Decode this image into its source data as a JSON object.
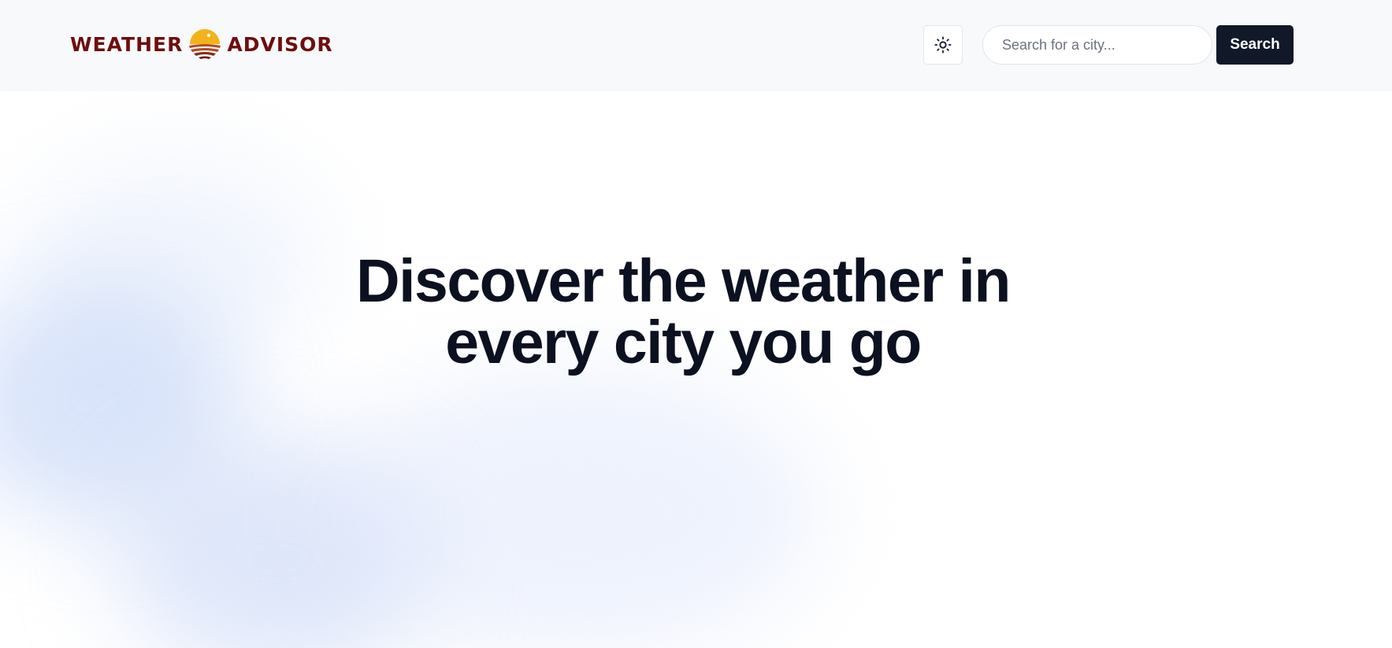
{
  "header": {
    "logo": {
      "word_left": "WEATHER",
      "word_right": "ADVISOR",
      "icon": "sunset-logo-icon",
      "text_color": "#6e0e0e",
      "sun_color": "#f2b21b",
      "stripe_color": "#b4491e"
    },
    "theme_toggle": {
      "icon": "sun-icon"
    },
    "search": {
      "placeholder": "Search for a city...",
      "value": "",
      "button_label": "Search",
      "button_color": "#111827"
    }
  },
  "hero": {
    "title_line1": "Discover the weather in",
    "title_line2": "every city you go",
    "title_color": "#0b1120"
  }
}
